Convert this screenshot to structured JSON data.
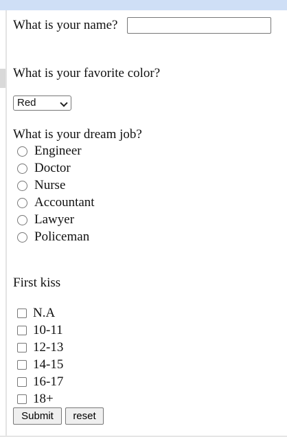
{
  "form": {
    "name_question": "What is your name?",
    "name_value": "",
    "color_question": "What is your favorite color?",
    "color_selected": "Red",
    "job_question": "What is your dream job?",
    "jobs": [
      "Engineer",
      "Doctor",
      "Nurse",
      "Accountant",
      "Lawyer",
      "Policeman"
    ],
    "kiss_question": "First kiss",
    "kiss_options": [
      "N.A",
      "10-11",
      "12-13",
      "14-15",
      "16-17",
      "18+"
    ],
    "submit_label": "Submit",
    "reset_label": "reset"
  }
}
